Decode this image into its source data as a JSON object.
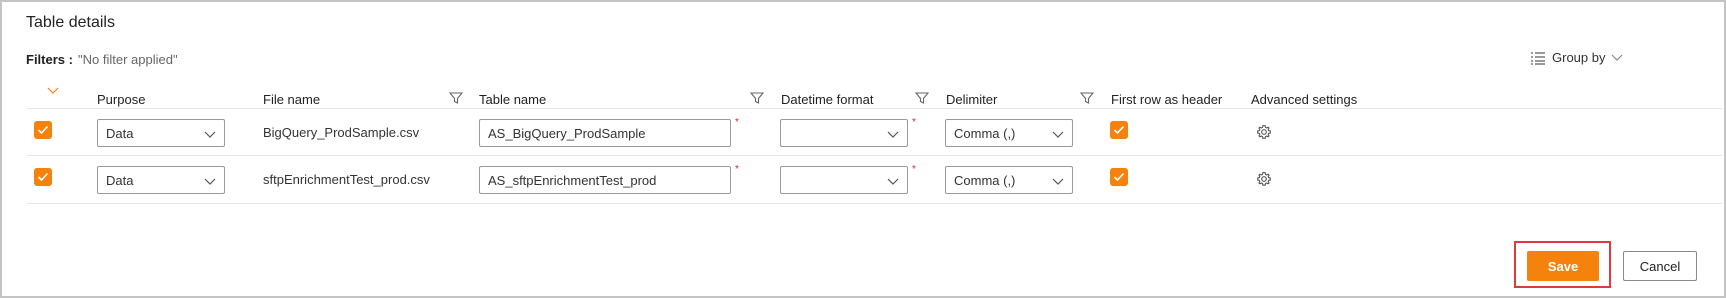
{
  "section": {
    "title": "Table details"
  },
  "filters": {
    "label": "Filters :",
    "value": "\"No filter applied\""
  },
  "groupby": {
    "label": "Group by"
  },
  "columns": {
    "purpose": "Purpose",
    "file_name": "File name",
    "table_name": "Table name",
    "datetime_format": "Datetime format",
    "delimiter": "Delimiter",
    "first_row_header": "First row as header",
    "advanced": "Advanced settings"
  },
  "rows": [
    {
      "checked": true,
      "purpose": "Data",
      "file_name": "BigQuery_ProdSample.csv",
      "table_name": "AS_BigQuery_ProdSample",
      "datetime_format": "",
      "delimiter": "Comma (,)",
      "first_row_header": true
    },
    {
      "checked": true,
      "purpose": "Data",
      "file_name": "sftpEnrichmentTest_prod.csv",
      "table_name": "AS_sftpEnrichmentTest_prod",
      "datetime_format": "",
      "delimiter": "Comma (,)",
      "first_row_header": true
    }
  ],
  "required_mark": "*",
  "buttons": {
    "save": "Save",
    "cancel": "Cancel"
  },
  "colors": {
    "accent": "#f5820d",
    "highlight": "#e03a3f"
  }
}
